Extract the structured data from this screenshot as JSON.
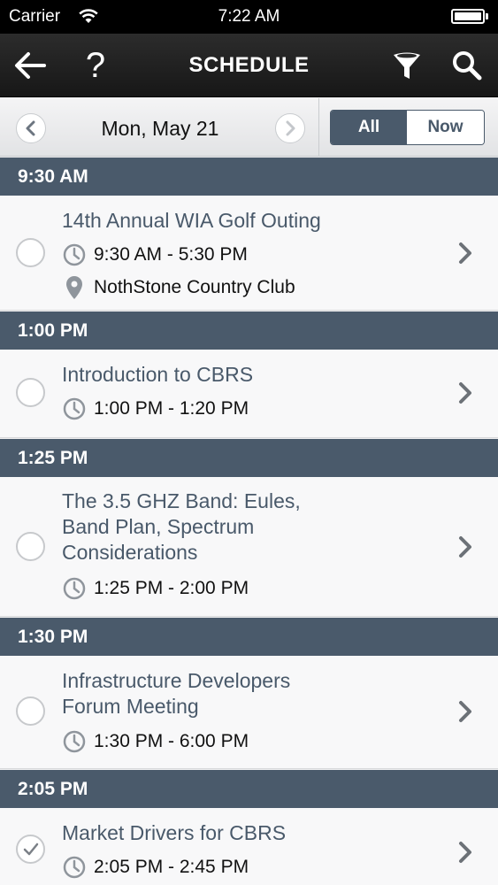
{
  "status_bar": {
    "carrier": "Carrier",
    "time": "7:22 AM"
  },
  "nav": {
    "title": "SCHEDULE"
  },
  "date_bar": {
    "date": "Mon, May 21",
    "segments": {
      "all": "All",
      "now": "Now",
      "selected": "All"
    }
  },
  "sections": [
    {
      "time": "9:30 AM",
      "items": [
        {
          "title_lines": [
            "14th Annual WIA Golf Outing"
          ],
          "time_range": "9:30 AM - 5:30 PM",
          "location": "NothStone Country Club",
          "checked": false
        }
      ]
    },
    {
      "time": "1:00 PM",
      "items": [
        {
          "title_lines": [
            "Introduction to CBRS"
          ],
          "time_range": "1:00 PM - 1:20 PM",
          "checked": false
        }
      ]
    },
    {
      "time": "1:25 PM",
      "items": [
        {
          "title_lines": [
            "The 3.5 GHZ Band: Eules,",
            "Band Plan, Spectrum",
            "Considerations"
          ],
          "time_range": "1:25 PM - 2:00 PM",
          "checked": false
        }
      ]
    },
    {
      "time": "1:30 PM",
      "items": [
        {
          "title_lines": [
            "Infrastructure Developers",
            "Forum Meeting"
          ],
          "time_range": "1:30 PM - 6:00 PM",
          "checked": false
        }
      ]
    },
    {
      "time": "2:05 PM",
      "items": [
        {
          "title_lines": [
            "Market Drivers for CBRS"
          ],
          "time_range": "2:05 PM - 2:45 PM",
          "checked": true
        }
      ]
    }
  ],
  "colors": {
    "header_bg": "#4a5a6b",
    "title_text": "#49596a",
    "nav_bg": "#1f1f1f"
  }
}
